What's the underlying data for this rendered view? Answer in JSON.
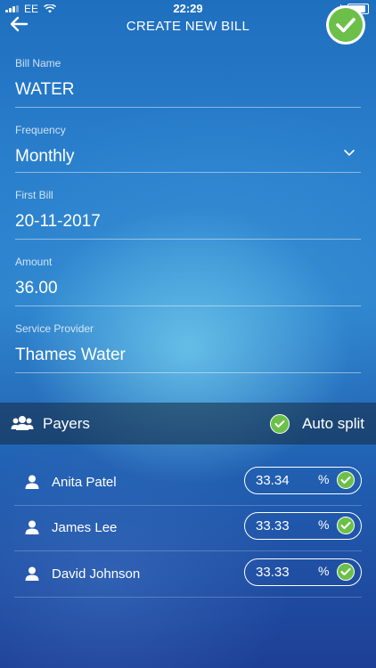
{
  "status_bar": {
    "carrier": "EE",
    "time": "22:29"
  },
  "nav": {
    "title": "CREATE NEW BILL"
  },
  "form": {
    "bill_name": {
      "label": "Bill Name",
      "value": "WATER"
    },
    "frequency": {
      "label": "Frequency",
      "value": "Monthly"
    },
    "first_bill": {
      "label": "First Bill",
      "value": "20-11-2017"
    },
    "amount": {
      "label": "Amount",
      "value": "36.00"
    },
    "service_provider": {
      "label": "Service Provider",
      "value": "Thames Water"
    }
  },
  "payers": {
    "title": "Payers",
    "auto_split_label": "Auto split",
    "auto_split_enabled": true,
    "list": [
      {
        "name": "Anita Patel",
        "percent": "33.34",
        "unit": "%"
      },
      {
        "name": "James Lee",
        "percent": "33.33",
        "unit": "%"
      },
      {
        "name": "David Johnson",
        "percent": "33.33",
        "unit": "%"
      }
    ]
  },
  "colors": {
    "accent_green": "#6cc04a",
    "background_top": "#1f6fbf",
    "background_bottom": "#1d3f95"
  }
}
